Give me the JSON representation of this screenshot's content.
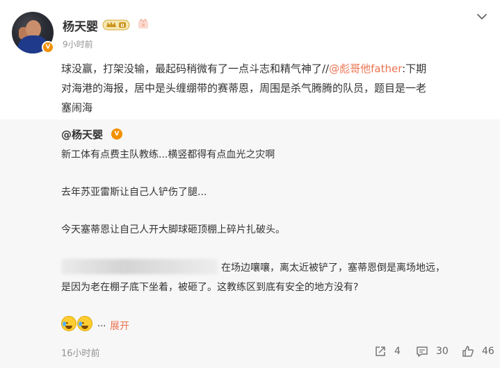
{
  "post": {
    "username": "杨天婴",
    "time": "9小时前",
    "text_prefix": "球没赢，打架没输，最起码稍微有了一点斗志和精气神了//",
    "mention": "@彪哥他father",
    "text_suffix_1": ":下期",
    "text_line_2": "对海港的海报，居中是头缠绷带的赛蒂恩，周围是杀气腾腾的队员，题目是一老",
    "text_line_3": "塞闹海"
  },
  "repost": {
    "username": "@杨天婴",
    "line1": "新工体有点费主队教练...横竖都得有点血光之灾啊",
    "line2": "去年苏亚雷斯让自己人铲伤了腿...",
    "line3": "今天塞蒂恩让自己人开大脚球砸顶棚上碎片扎破头。",
    "line4": "在场边嚷嚷，离太近被铲了，塞蒂恩倒是离场地远，",
    "line5": "是因为老在棚子底下坐着，被砸了。这教练区到底有安全的地方没有?",
    "dots": "...",
    "expand_label": "展开",
    "time": "16小时前",
    "actions": {
      "share_count": "4",
      "comment_count": "30",
      "like_count": "46"
    }
  },
  "colors": {
    "accent_link": "#eb7350",
    "verified": "#f29100",
    "repost_bg": "#f7f7f7",
    "muted_text": "#939393"
  },
  "icons": [
    "chevron-down-icon",
    "crown-level-icon",
    "badge-icon",
    "verified-icon",
    "laugh-cry-emoji",
    "share-icon",
    "comment-icon",
    "like-icon"
  ]
}
